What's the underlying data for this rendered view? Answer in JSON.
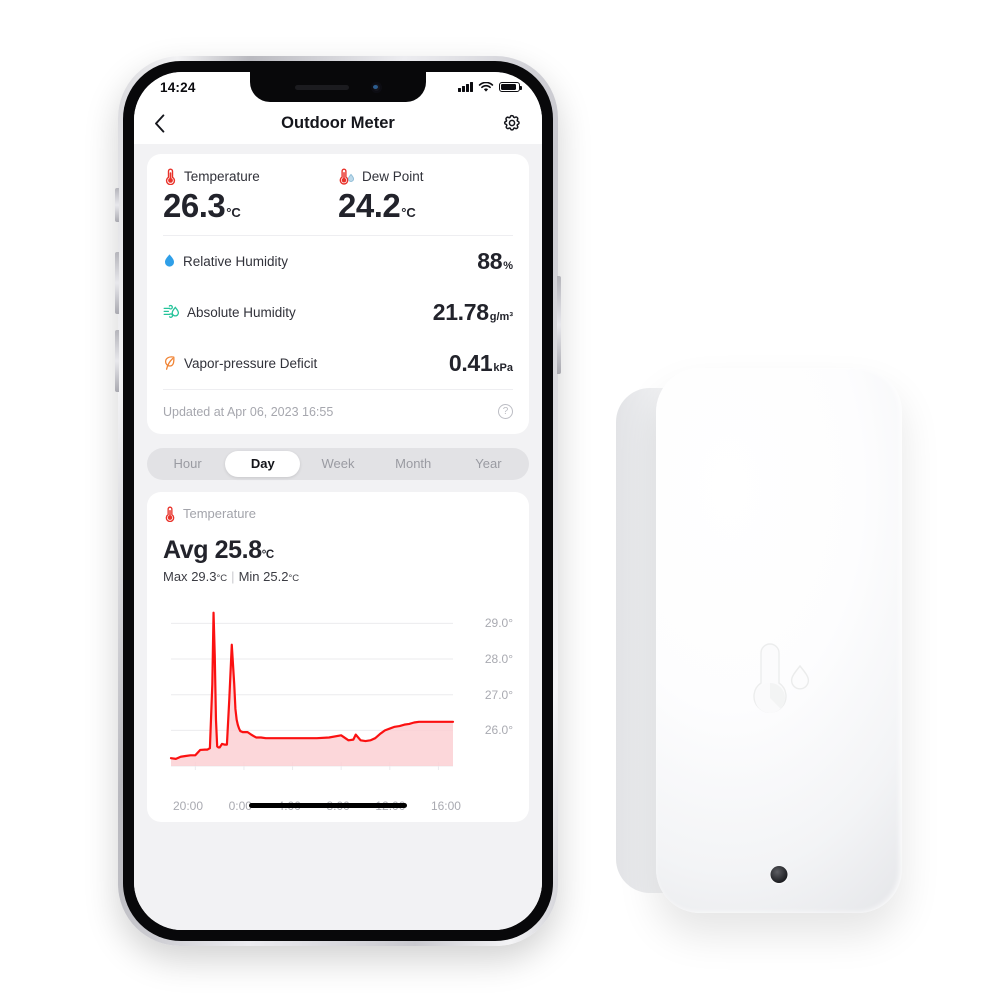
{
  "status_bar": {
    "time": "14:24",
    "signal_icon": "signal-bars-icon",
    "wifi_icon": "wifi-icon",
    "battery_icon": "battery-icon"
  },
  "nav": {
    "back_icon": "chevron-left-icon",
    "title": "Outdoor Meter",
    "settings_icon": "gear-icon"
  },
  "readings": {
    "primary": [
      {
        "icon": "thermometer-icon",
        "label": "Temperature",
        "value": "26.3",
        "unit": "°C"
      },
      {
        "icon": "dew-point-icon",
        "label": "Dew Point",
        "value": "24.2",
        "unit": "°C"
      }
    ],
    "rows": [
      {
        "icon": "water-drop-icon",
        "label": "Relative Humidity",
        "value": "88",
        "unit": "%"
      },
      {
        "icon": "absolute-humidity-icon",
        "label": "Absolute Humidity",
        "value": "21.78",
        "unit": "g/m³"
      },
      {
        "icon": "leaf-icon",
        "label": "Vapor-pressure Deficit",
        "value": "0.41",
        "unit": "kPa"
      }
    ],
    "updated_text": "Updated at Apr 06, 2023 16:55",
    "help_icon": "question-mark-icon"
  },
  "range_tabs": {
    "items": [
      "Hour",
      "Day",
      "Week",
      "Month",
      "Year"
    ],
    "selected": "Day"
  },
  "chart_card": {
    "icon": "thermometer-icon",
    "label": "Temperature",
    "avg_prefix": "Avg",
    "avg_value": "25.8",
    "avg_unit": "°C",
    "max_label": "Max",
    "max_value": "29.3",
    "max_unit": "°C",
    "separator": "|",
    "min_label": "Min",
    "min_value": "25.2",
    "min_unit": "°C"
  },
  "colors": {
    "line": "#fb1111",
    "fill": "#fcd0d3",
    "temperature_icon": "#e8322a",
    "humidity_icon": "#2f9fe8",
    "absolute_humidity_icon": "#25c39a",
    "leaf_icon": "#f08435",
    "text_primary": "#22232b",
    "text_muted": "#a9aab1",
    "card_bg": "#ffffff",
    "page_bg": "#f2f2f4"
  },
  "chart_data": {
    "type": "area",
    "title": "Temperature",
    "xlabel": "",
    "ylabel": "°C",
    "ylim": [
      25.0,
      29.6
    ],
    "xlim": [
      18.0,
      17.2
    ],
    "grid": true,
    "legend": false,
    "y_ticks": [
      "29.0°",
      "28.0°",
      "27.0°",
      "26.0°"
    ],
    "y_tick_values": [
      29.0,
      28.0,
      27.0,
      26.0
    ],
    "x_ticks": [
      "20:00",
      "0:00",
      "4:00",
      "8:00",
      "12:00",
      "16:00"
    ],
    "x_tick_hours": [
      20,
      24,
      28,
      32,
      36,
      40
    ],
    "series": [
      {
        "name": "Temperature",
        "unit": "°C",
        "x": [
          18.0,
          18.4,
          18.8,
          19.2,
          19.6,
          20.0,
          20.4,
          20.8,
          21.0,
          21.2,
          21.4,
          21.5,
          21.6,
          21.7,
          21.8,
          21.9,
          22.0,
          22.2,
          22.4,
          22.6,
          22.8,
          23.0,
          23.2,
          23.3,
          23.4,
          23.5,
          23.6,
          23.7,
          23.9,
          24.1,
          24.3,
          24.6,
          25.0,
          25.4,
          25.8,
          26.2,
          26.6,
          27.0,
          27.6,
          28.2,
          29.0,
          30.0,
          31.0,
          32.0,
          32.6,
          33.0,
          33.2,
          33.6,
          34.0,
          34.4,
          34.8,
          35.2,
          35.6,
          36.0,
          36.4,
          36.8,
          37.2,
          37.6,
          38.0,
          38.4,
          38.8,
          39.2,
          39.6,
          40.0,
          40.6,
          41.2
        ],
        "y": [
          25.22,
          25.2,
          25.26,
          25.28,
          25.3,
          25.3,
          25.45,
          25.46,
          25.46,
          25.5,
          27.3,
          29.3,
          28.1,
          26.3,
          25.55,
          25.52,
          25.52,
          25.62,
          25.6,
          25.6,
          26.9,
          28.4,
          27.3,
          26.6,
          26.3,
          26.15,
          26.05,
          25.98,
          25.95,
          25.95,
          25.95,
          25.88,
          25.8,
          25.8,
          25.78,
          25.78,
          25.78,
          25.78,
          25.78,
          25.78,
          25.78,
          25.78,
          25.8,
          25.86,
          25.72,
          25.74,
          25.88,
          25.72,
          25.7,
          25.72,
          25.78,
          25.9,
          26.0,
          26.05,
          26.1,
          26.12,
          26.16,
          26.18,
          26.22,
          26.24,
          26.24,
          26.24,
          26.24,
          26.24,
          26.24,
          26.24
        ]
      }
    ],
    "annotations": {
      "avg": 25.8,
      "max": 29.3,
      "min": 25.2
    }
  },
  "device": {
    "name": "outdoor-meter-sensor",
    "logo_icon": "thermometer-droplet-emboss-icon",
    "hole_icon": "sensor-hole-icon"
  }
}
